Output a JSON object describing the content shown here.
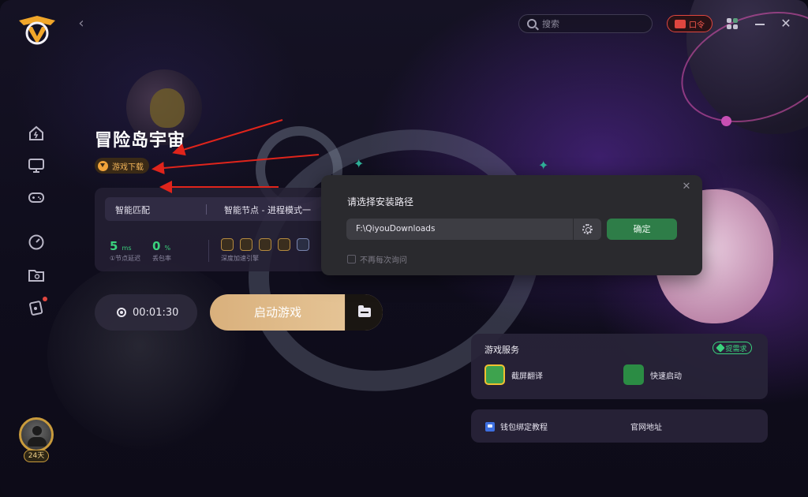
{
  "header": {
    "search_placeholder": "搜索",
    "kouling_label": "口令"
  },
  "game": {
    "title": "冒险岛宇宙",
    "download_label": "游戏下载"
  },
  "info_panel": {
    "tab_match": "智能匹配",
    "tab_node": "智能节点 - 进程模式一",
    "latency_value": "5",
    "latency_unit": "ms",
    "latency_label": "①节点延迟",
    "loss_value": "0",
    "loss_unit": "%",
    "loss_label": "丢包率",
    "engine_label": "深度加速引擎"
  },
  "controls": {
    "timer": "00:01:30",
    "launch_label": "启动游戏"
  },
  "dialog": {
    "title": "请选择安装路径",
    "path": "F:\\QiyouDownloads",
    "confirm_label": "确定",
    "dont_ask_label": "不再每次询问",
    "dont_ask_checked": false
  },
  "services": {
    "title": "游戏服务",
    "request_label": "提需求",
    "items": [
      {
        "label": "截屏翻译",
        "icon": "screenshot-translate-icon"
      },
      {
        "label": "快速启动",
        "icon": "quick-launch-icon"
      }
    ]
  },
  "links": {
    "items": [
      {
        "label": "钱包绑定教程",
        "icon": "wallet-icon"
      },
      {
        "label": "官网地址",
        "icon": ""
      }
    ]
  },
  "user": {
    "days_badge": "24天"
  },
  "colors": {
    "accent_green": "#3ad27d",
    "confirm_green": "#2e7d48",
    "launch_gold": "#d9b07c",
    "alert_red": "#e0463f",
    "arrow_red": "#e0241b"
  }
}
